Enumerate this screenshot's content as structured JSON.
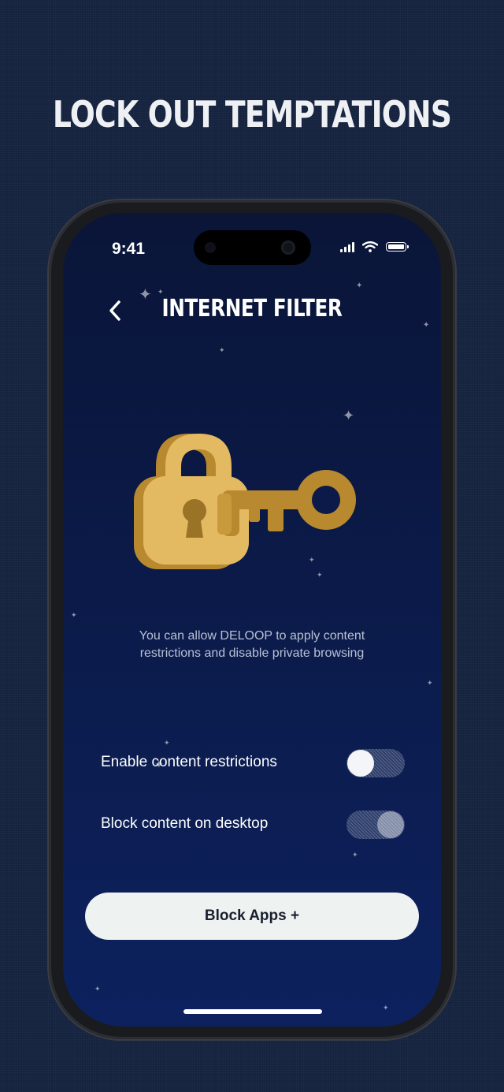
{
  "promo": {
    "headline": "LOCK OUT TEMPTATIONS"
  },
  "status_bar": {
    "time": "9:41"
  },
  "nav": {
    "title": "INTERNET FILTER",
    "back_icon": "chevron-left-icon"
  },
  "illustration": {
    "name": "padlock-with-key",
    "colors": {
      "lock": "#e3b962",
      "key": "#b8892f"
    }
  },
  "description": "You can allow DELOOP to apply content restrictions and disable private browsing",
  "settings": [
    {
      "label": "Enable content restrictions",
      "enabled": false
    },
    {
      "label": "Block content on desktop",
      "enabled": true
    }
  ],
  "cta": {
    "label": "Block Apps +"
  },
  "colors": {
    "background": "#15233f",
    "screen_top": "#0a1538",
    "screen_bottom": "#0c215e",
    "button": "#eef2f1"
  }
}
